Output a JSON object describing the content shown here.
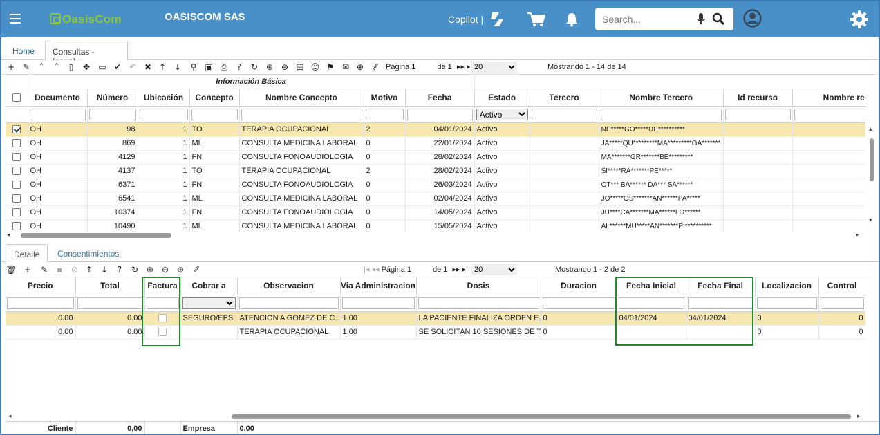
{
  "header": {
    "logo_text": "OasisCom",
    "company": "OASISCOM SAS",
    "copilot": "Copilot |",
    "search_placeholder": "Search..."
  },
  "tabs": {
    "home": "Home",
    "active": "Consultas -[gcon]",
    "close": "×"
  },
  "top_pager": {
    "page_label": "Página",
    "page_value": "1",
    "of_label": "de 1",
    "page_size": "20",
    "showing": "Mostrando 1 - 14 de 14"
  },
  "main_grid": {
    "group_header": "Información Básica",
    "estado_filter": "Activo",
    "columns": [
      "Documento",
      "Número",
      "Ubicación",
      "Concepto",
      "Nombre Concepto",
      "Motivo",
      "Fecha",
      "Estado",
      "Tercero",
      "Nombre Tercero",
      "Id recurso",
      "Nombre recurs"
    ],
    "rows": [
      {
        "doc": "OH",
        "num": "98",
        "ubi": "1",
        "con": "TO",
        "nom": "TERAPIA OCUPACIONAL",
        "mot": "2",
        "fecha": "04/01/2024",
        "estado": "Activo",
        "nter": "NE*****GO*****DE**********"
      },
      {
        "doc": "OH",
        "num": "869",
        "ubi": "1",
        "con": "ML",
        "nom": "CONSULTA MEDICINA LABORAL",
        "mot": "0",
        "fecha": "22/01/2024",
        "estado": "Activo",
        "nter": "JA*****QU*********MA*********GA*******"
      },
      {
        "doc": "OH",
        "num": "4129",
        "ubi": "1",
        "con": "FN",
        "nom": "CONSULTA FONOAUDIOLOGIA",
        "mot": "0",
        "fecha": "28/02/2024",
        "estado": "Activo",
        "nter": "MA*******GR*******BE*********"
      },
      {
        "doc": "OH",
        "num": "4137",
        "ubi": "1",
        "con": "TO",
        "nom": "TERAPIA OCUPACIONAL",
        "mot": "2",
        "fecha": "28/02/2024",
        "estado": "Activo",
        "nter": "SI*****RA*******PE*****"
      },
      {
        "doc": "OH",
        "num": "6371",
        "ubi": "1",
        "con": "FN",
        "nom": "CONSULTA FONOAUDIOLOGIA",
        "mot": "0",
        "fecha": "26/03/2024",
        "estado": "Activo",
        "nter": "OT*** BA****** DA*** SA******"
      },
      {
        "doc": "OH",
        "num": "6541",
        "ubi": "1",
        "con": "ML",
        "nom": "CONSULTA MEDICINA LABORAL",
        "mot": "0",
        "fecha": "02/04/2024",
        "estado": "Activo",
        "nter": "JO*****OS*******AN******PA*****"
      },
      {
        "doc": "OH",
        "num": "10374",
        "ubi": "1",
        "con": "FN",
        "nom": "CONSULTA FONOAUDIOLOGIA",
        "mot": "0",
        "fecha": "14/05/2024",
        "estado": "Activo",
        "nter": "JU****CA*******MA******LO******"
      },
      {
        "doc": "OH",
        "num": "10490",
        "ubi": "1",
        "con": "ML",
        "nom": "CONSULTA MEDICINA LABORAL",
        "mot": "0",
        "fecha": "15/05/2024",
        "estado": "Activo",
        "nter": "AL******MU*****AN*******PI**********"
      }
    ]
  },
  "detail_tabs": {
    "detalle": "Detalle",
    "consentimientos": "Consentimientos"
  },
  "detail_pager": {
    "page_label": "Página",
    "page_value": "1",
    "of_label": "de 1",
    "page_size": "20",
    "showing": "Mostrando 1 - 2 de 2"
  },
  "detail_grid": {
    "columns": [
      "Precio",
      "Total",
      "Factura",
      "Cobrar a",
      "Observacion",
      "Via Administracion",
      "Dosis",
      "Duracion",
      "Fecha Inicial",
      "Fecha Final",
      "Localizacion",
      "Control"
    ],
    "rows": [
      {
        "precio": "0.00",
        "total": "0.00",
        "cobrar": "SEGURO/EPS",
        "obs": "ATENCION A GOMEZ DE C...",
        "via": "1,00",
        "dosis": "LA PACIENTE FINALIZA ORDEN E...",
        "dur": "0",
        "fini": "04/01/2024",
        "ffin": "04/01/2024",
        "loc": "0",
        "ctrl": "0"
      },
      {
        "precio": "0.00",
        "total": "0.00",
        "cobrar": "",
        "obs": "TERAPIA OCUPACIONAL",
        "via": "1,00",
        "dosis": "SE SOLICITAN 10 SESIONES DE T...",
        "dur": "0",
        "fini": "",
        "ffin": "",
        "loc": "0",
        "ctrl": "0"
      }
    ]
  },
  "footer": {
    "cliente_label": "Cliente",
    "cliente_value": "0,00",
    "empresa_label": "Empresa",
    "empresa_value": "0,00"
  },
  "colors": {
    "header_bg": "#4a90c8",
    "selected_row": "#f6e7b0",
    "highlight_box": "#1e8a2e",
    "link": "#2e6da4"
  }
}
